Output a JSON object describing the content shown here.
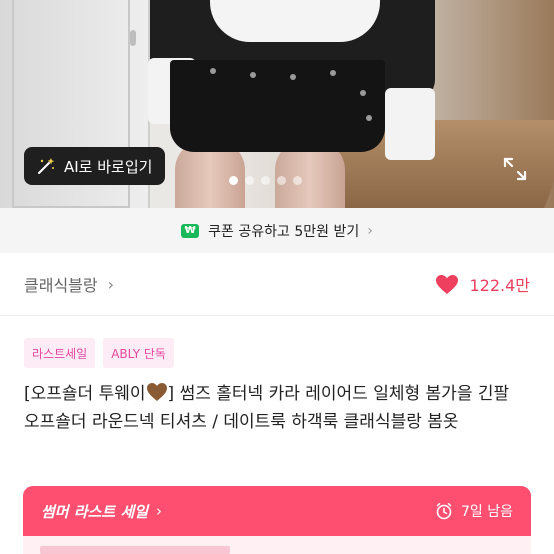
{
  "hero": {
    "ai_button_label": "AI로 바로입기",
    "carousel_dots": 5,
    "active_dot": 0
  },
  "coupon": {
    "badge": "₩",
    "text": "쿠폰 공유하고 5만원 받기"
  },
  "store": {
    "name": "클래식블랑",
    "likes": "122.4만"
  },
  "badges": [
    "라스트세일",
    "ABLY 단독"
  ],
  "product": {
    "title_part1": "[오프숄더 투웨이",
    "title_part2": "] 썸즈 홀터넥 카라 레이어드 일체형 봄가을 긴팔 오프숄더 라운드넥 티셔츠 / 데이트룩 하객룩 클래식블랑 봄옷"
  },
  "sale": {
    "label": "썸머 라스트 세일",
    "remaining": "7일 남음"
  },
  "colors": {
    "accent_pink": "#ff4f70",
    "heart": "#ee3f5f",
    "badge_bg": "#fdecf6",
    "badge_text": "#e5479f",
    "won_green": "#19b95a"
  }
}
